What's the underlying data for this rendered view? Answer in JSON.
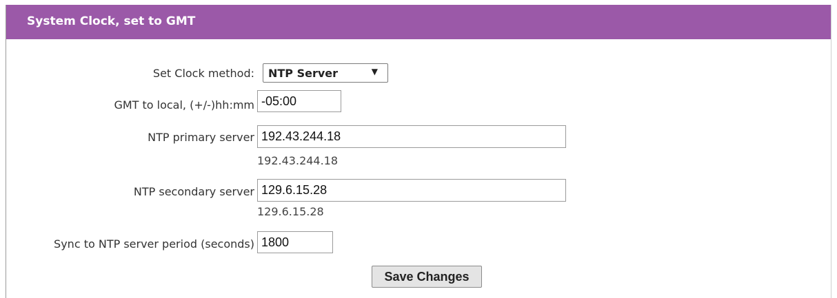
{
  "panel": {
    "title": "System Clock, set to GMT"
  },
  "form": {
    "clock_method": {
      "label": "Set Clock method:",
      "value": "NTP Server",
      "arrow_icon": "dropdown-arrow-icon"
    },
    "gmt_offset": {
      "label": "GMT to local, (+/-)hh:mm",
      "value": "-05:00"
    },
    "ntp_primary": {
      "label": "NTP primary server",
      "value": "192.43.244.18",
      "current": "192.43.244.18"
    },
    "ntp_secondary": {
      "label": "NTP secondary server",
      "value": "129.6.15.28",
      "current": "129.6.15.28"
    },
    "sync_period": {
      "label": "Sync to NTP server period (seconds)",
      "value": "1800"
    },
    "save_label": "Save Changes"
  },
  "colors": {
    "header": "#9b59a8",
    "header_text": "#ffffff"
  }
}
